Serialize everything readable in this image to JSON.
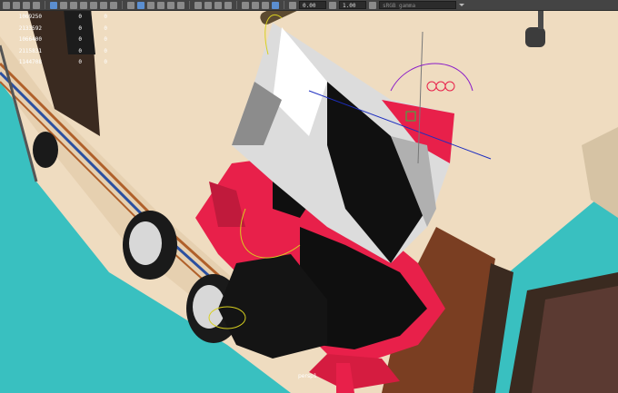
{
  "toolbar": {
    "field1_value": "0.00",
    "field2_value": "1.00",
    "camera_field_value": "sRGB gamma"
  },
  "hud": {
    "rows": [
      [
        "1069250",
        "0",
        "0"
      ],
      [
        "2133592",
        "0",
        "0"
      ],
      [
        "1066400",
        "0",
        "0"
      ],
      [
        "2115831",
        "0",
        "0"
      ],
      [
        "1144708",
        "0",
        "0"
      ]
    ]
  },
  "viewport": {
    "camera_label": "persp1",
    "colors": {
      "background": "#39c0c0",
      "bus_body": "#efdcc0",
      "stripe_blue": "#2a4fa0",
      "stripe_orange": "#b0602a",
      "object_red": "#e8204a",
      "object_silver": "#d8d8d8",
      "handle_blue": "#1d2ec0",
      "handle_purple": "#8a1cc8"
    }
  }
}
